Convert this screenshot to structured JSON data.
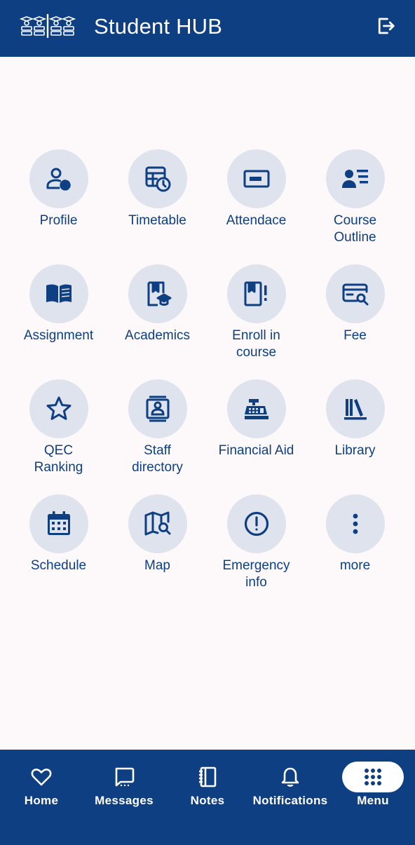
{
  "header": {
    "title": "Student HUB",
    "logo_icon": "students-group-logo",
    "logout_icon": "logout-icon"
  },
  "menu": {
    "items": [
      {
        "label": "Profile",
        "icon": "profile-settings-icon"
      },
      {
        "label": "Timetable",
        "icon": "timetable-icon"
      },
      {
        "label": "Attendace",
        "icon": "id-card-icon"
      },
      {
        "label": "Course\nOutline",
        "icon": "course-outline-icon"
      },
      {
        "label": "Assignment",
        "icon": "open-book-icon"
      },
      {
        "label": "Academics",
        "icon": "academics-icon"
      },
      {
        "label": "Enroll in\ncourse",
        "icon": "enroll-book-icon"
      },
      {
        "label": "Fee",
        "icon": "fee-search-icon"
      },
      {
        "label": "QEC\nRanking",
        "icon": "star-icon"
      },
      {
        "label": "Staff\ndirectory",
        "icon": "staff-directory-icon"
      },
      {
        "label": "Financial Aid",
        "icon": "cash-register-icon"
      },
      {
        "label": "Library",
        "icon": "library-books-icon"
      },
      {
        "label": "Schedule",
        "icon": "calendar-icon"
      },
      {
        "label": "Map",
        "icon": "map-search-icon"
      },
      {
        "label": "Emergency\ninfo",
        "icon": "alert-circle-icon"
      },
      {
        "label": "more",
        "icon": "more-vertical-icon"
      }
    ]
  },
  "bottom_nav": {
    "items": [
      {
        "label": "Home",
        "icon": "heart-icon"
      },
      {
        "label": "Messages",
        "icon": "message-icon"
      },
      {
        "label": "Notes",
        "icon": "notebook-icon"
      },
      {
        "label": "Notifications",
        "icon": "bell-icon"
      },
      {
        "label": "Menu",
        "icon": "grid-dots-icon",
        "active": true
      }
    ]
  },
  "colors": {
    "primary": "#0d3f82",
    "tile_bg": "#dfe3ee",
    "page_bg": "#fdf9fb"
  }
}
